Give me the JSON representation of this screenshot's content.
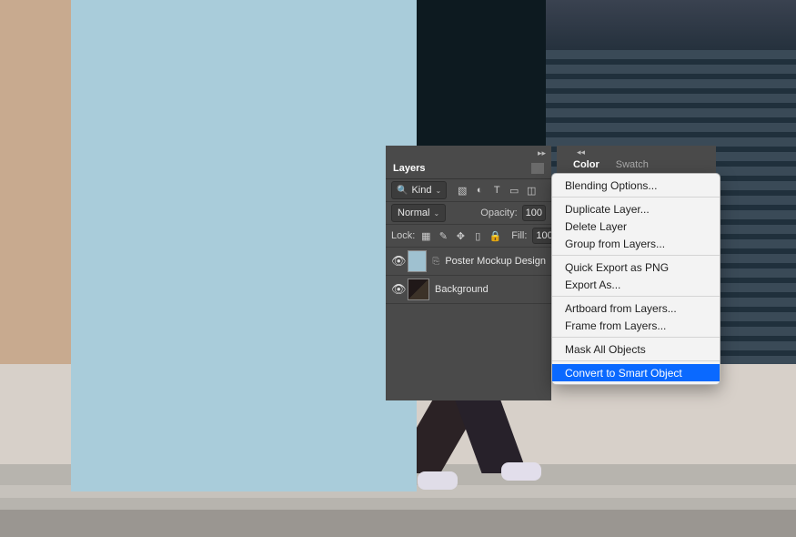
{
  "panel": {
    "tab": "Layers",
    "filter": {
      "kind_label": "Kind"
    },
    "blend": {
      "mode": "Normal",
      "opacity_label": "Opacity:",
      "opacity_value": "100"
    },
    "lock": {
      "label": "Lock:",
      "fill_label": "Fill:",
      "fill_value": "100"
    },
    "layers": [
      {
        "name": "Poster Mockup Design"
      },
      {
        "name": "Background"
      }
    ]
  },
  "right_panel": {
    "tabs": [
      "Color",
      "Swatch"
    ]
  },
  "context_menu": {
    "items": [
      "Blending Options...",
      "-",
      "Duplicate Layer...",
      "Delete Layer",
      "Group from Layers...",
      "-",
      "Quick Export as PNG",
      "Export As...",
      "-",
      "Artboard from Layers...",
      "Frame from Layers...",
      "-",
      "Mask All Objects",
      "-",
      "Convert to Smart Object"
    ],
    "selected": "Convert to Smart Object"
  }
}
